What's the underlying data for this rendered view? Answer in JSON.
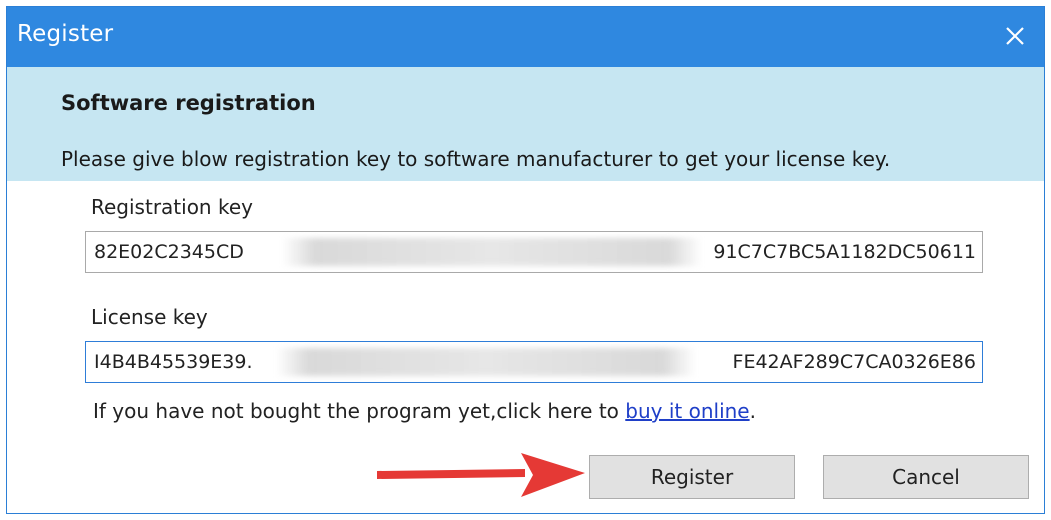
{
  "window": {
    "title": "Register",
    "close_icon": "close-icon"
  },
  "header": {
    "heading": "Software registration",
    "description": "Please give blow registration key to software manufacturer to get your license key."
  },
  "registration": {
    "label": "Registration key",
    "value_start": "82E02C2345CD",
    "value_end": "91C7C7BC5A1182DC50611"
  },
  "license": {
    "label": "License key",
    "value_start": "I4B4B45539E39.",
    "value_end": "FE42AF289C7CA0326E86"
  },
  "note": {
    "text": "If you have not bought the program yet,click here to ",
    "link": "buy it online",
    "suffix": "."
  },
  "buttons": {
    "register": "Register",
    "cancel": "Cancel"
  },
  "colors": {
    "titlebar": "#2f88e0",
    "header_band": "#c6e6f2",
    "link": "#1f3fc8",
    "arrow": "#e53935"
  }
}
